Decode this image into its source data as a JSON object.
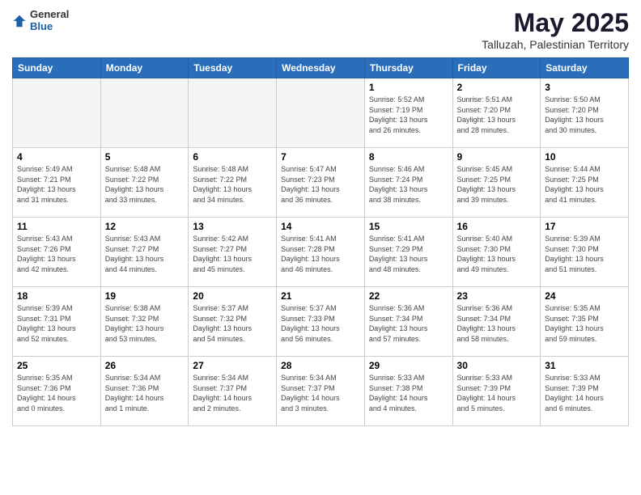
{
  "header": {
    "logo_general": "General",
    "logo_blue": "Blue",
    "month_title": "May 2025",
    "subtitle": "Talluzah, Palestinian Territory"
  },
  "weekdays": [
    "Sunday",
    "Monday",
    "Tuesday",
    "Wednesday",
    "Thursday",
    "Friday",
    "Saturday"
  ],
  "weeks": [
    [
      {
        "day": "",
        "info": ""
      },
      {
        "day": "",
        "info": ""
      },
      {
        "day": "",
        "info": ""
      },
      {
        "day": "",
        "info": ""
      },
      {
        "day": "1",
        "info": "Sunrise: 5:52 AM\nSunset: 7:19 PM\nDaylight: 13 hours\nand 26 minutes."
      },
      {
        "day": "2",
        "info": "Sunrise: 5:51 AM\nSunset: 7:20 PM\nDaylight: 13 hours\nand 28 minutes."
      },
      {
        "day": "3",
        "info": "Sunrise: 5:50 AM\nSunset: 7:20 PM\nDaylight: 13 hours\nand 30 minutes."
      }
    ],
    [
      {
        "day": "4",
        "info": "Sunrise: 5:49 AM\nSunset: 7:21 PM\nDaylight: 13 hours\nand 31 minutes."
      },
      {
        "day": "5",
        "info": "Sunrise: 5:48 AM\nSunset: 7:22 PM\nDaylight: 13 hours\nand 33 minutes."
      },
      {
        "day": "6",
        "info": "Sunrise: 5:48 AM\nSunset: 7:22 PM\nDaylight: 13 hours\nand 34 minutes."
      },
      {
        "day": "7",
        "info": "Sunrise: 5:47 AM\nSunset: 7:23 PM\nDaylight: 13 hours\nand 36 minutes."
      },
      {
        "day": "8",
        "info": "Sunrise: 5:46 AM\nSunset: 7:24 PM\nDaylight: 13 hours\nand 38 minutes."
      },
      {
        "day": "9",
        "info": "Sunrise: 5:45 AM\nSunset: 7:25 PM\nDaylight: 13 hours\nand 39 minutes."
      },
      {
        "day": "10",
        "info": "Sunrise: 5:44 AM\nSunset: 7:25 PM\nDaylight: 13 hours\nand 41 minutes."
      }
    ],
    [
      {
        "day": "11",
        "info": "Sunrise: 5:43 AM\nSunset: 7:26 PM\nDaylight: 13 hours\nand 42 minutes."
      },
      {
        "day": "12",
        "info": "Sunrise: 5:43 AM\nSunset: 7:27 PM\nDaylight: 13 hours\nand 44 minutes."
      },
      {
        "day": "13",
        "info": "Sunrise: 5:42 AM\nSunset: 7:27 PM\nDaylight: 13 hours\nand 45 minutes."
      },
      {
        "day": "14",
        "info": "Sunrise: 5:41 AM\nSunset: 7:28 PM\nDaylight: 13 hours\nand 46 minutes."
      },
      {
        "day": "15",
        "info": "Sunrise: 5:41 AM\nSunset: 7:29 PM\nDaylight: 13 hours\nand 48 minutes."
      },
      {
        "day": "16",
        "info": "Sunrise: 5:40 AM\nSunset: 7:30 PM\nDaylight: 13 hours\nand 49 minutes."
      },
      {
        "day": "17",
        "info": "Sunrise: 5:39 AM\nSunset: 7:30 PM\nDaylight: 13 hours\nand 51 minutes."
      }
    ],
    [
      {
        "day": "18",
        "info": "Sunrise: 5:39 AM\nSunset: 7:31 PM\nDaylight: 13 hours\nand 52 minutes."
      },
      {
        "day": "19",
        "info": "Sunrise: 5:38 AM\nSunset: 7:32 PM\nDaylight: 13 hours\nand 53 minutes."
      },
      {
        "day": "20",
        "info": "Sunrise: 5:37 AM\nSunset: 7:32 PM\nDaylight: 13 hours\nand 54 minutes."
      },
      {
        "day": "21",
        "info": "Sunrise: 5:37 AM\nSunset: 7:33 PM\nDaylight: 13 hours\nand 56 minutes."
      },
      {
        "day": "22",
        "info": "Sunrise: 5:36 AM\nSunset: 7:34 PM\nDaylight: 13 hours\nand 57 minutes."
      },
      {
        "day": "23",
        "info": "Sunrise: 5:36 AM\nSunset: 7:34 PM\nDaylight: 13 hours\nand 58 minutes."
      },
      {
        "day": "24",
        "info": "Sunrise: 5:35 AM\nSunset: 7:35 PM\nDaylight: 13 hours\nand 59 minutes."
      }
    ],
    [
      {
        "day": "25",
        "info": "Sunrise: 5:35 AM\nSunset: 7:36 PM\nDaylight: 14 hours\nand 0 minutes."
      },
      {
        "day": "26",
        "info": "Sunrise: 5:34 AM\nSunset: 7:36 PM\nDaylight: 14 hours\nand 1 minute."
      },
      {
        "day": "27",
        "info": "Sunrise: 5:34 AM\nSunset: 7:37 PM\nDaylight: 14 hours\nand 2 minutes."
      },
      {
        "day": "28",
        "info": "Sunrise: 5:34 AM\nSunset: 7:37 PM\nDaylight: 14 hours\nand 3 minutes."
      },
      {
        "day": "29",
        "info": "Sunrise: 5:33 AM\nSunset: 7:38 PM\nDaylight: 14 hours\nand 4 minutes."
      },
      {
        "day": "30",
        "info": "Sunrise: 5:33 AM\nSunset: 7:39 PM\nDaylight: 14 hours\nand 5 minutes."
      },
      {
        "day": "31",
        "info": "Sunrise: 5:33 AM\nSunset: 7:39 PM\nDaylight: 14 hours\nand 6 minutes."
      }
    ]
  ]
}
